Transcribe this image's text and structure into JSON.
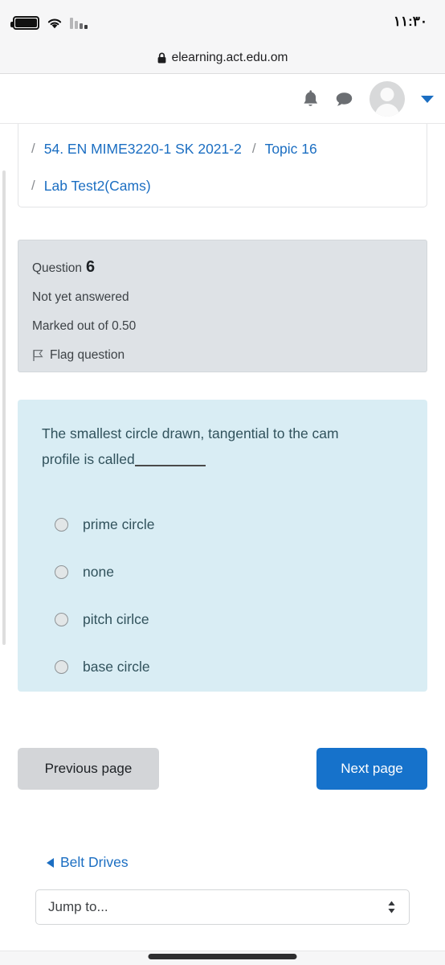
{
  "statusbar": {
    "time": "١١:٣٠",
    "battery_icon": "battery-full-icon",
    "wifi_icon": "wifi-icon",
    "signal_icon": "cellular-signal-icon"
  },
  "browser": {
    "url": "elearning.act.edu.om",
    "lock_icon": "lock-icon"
  },
  "sitenav": {
    "notifications_icon": "bell-icon",
    "messages_icon": "chat-bubble-icon",
    "avatar_icon": "user-avatar-icon",
    "menu_caret_icon": "chevron-down-icon"
  },
  "breadcrumb": {
    "separator": "/",
    "items": [
      {
        "label": "54. EN MIME3220-1 SK 2021-2"
      },
      {
        "label": "Topic 16"
      },
      {
        "label": "Lab Test2(Cams)"
      }
    ]
  },
  "question_info": {
    "question_word": "Question",
    "question_number": "6",
    "status": "Not yet answered",
    "marks": "Marked out of 0.50",
    "flag_label": "Flag question",
    "flag_icon": "flag-icon"
  },
  "question": {
    "text_before_blank": "The smallest circle drawn, tangential to the cam profile is called",
    "options": [
      {
        "label": "prime circle",
        "selected": false
      },
      {
        "label": "none",
        "selected": false
      },
      {
        "label": "pitch cirlce",
        "selected": false
      },
      {
        "label": "base circle",
        "selected": false
      }
    ]
  },
  "navigation": {
    "previous_page": "Previous page",
    "next_page": "Next page",
    "previous_activity": "Belt Drives",
    "previous_activity_icon": "triangle-left-icon",
    "jump_to_placeholder": "Jump to...",
    "jump_to_icon": "up-down-arrows-icon"
  },
  "colors": {
    "link_blue": "#1b6ec2",
    "primary_button": "#1672cb",
    "secondary_button": "#d3d5d8",
    "question_info_bg": "#dee2e6",
    "question_box_bg": "#d9edf4",
    "question_text": "#31525c"
  }
}
